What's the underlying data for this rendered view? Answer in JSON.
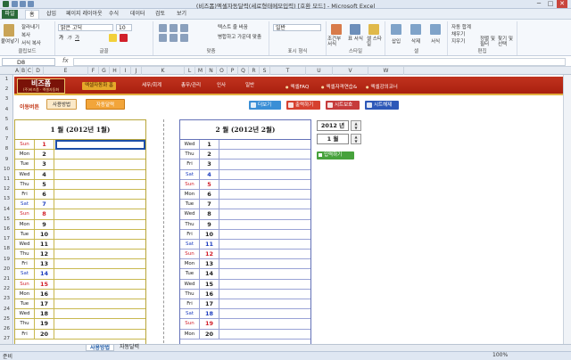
{
  "window": {
    "title": "(비즈폼)엑셀자동달력(세로형태메모입력) [호환 모드] - Microsoft Excel",
    "min": "─",
    "max": "□",
    "close": "✕"
  },
  "ribbon_tabs": [
    "파일",
    "홈",
    "삽입",
    "페이지 레이아웃",
    "수식",
    "데이터",
    "검토",
    "보기"
  ],
  "ribbon": {
    "clipboard": {
      "paste": "붙여넣기",
      "cut": "잘라내기",
      "copy": "복사",
      "format_painter": "서식 복사",
      "label": "클립보드"
    },
    "font": {
      "name": "맑은 고딕",
      "size": "10",
      "label": "글꼴"
    },
    "alignment": {
      "wrap": "텍스트 줄 바꿈",
      "merge": "병합하고 가운데 맞춤",
      "label": "맞춤"
    },
    "number": {
      "format": "일반",
      "label": "표시 형식"
    },
    "styles": {
      "conditional": "조건부 서식",
      "table": "표 서식",
      "cell": "셀 스타일",
      "label": "스타일"
    },
    "cells": {
      "insert": "삽입",
      "delete": "삭제",
      "format": "서식",
      "label": "셀"
    },
    "editing": {
      "autosum": "자동 합계",
      "fill": "채우기",
      "clear": "지우기",
      "sort": "정렬 및 필터",
      "find": "찾기 및 선택",
      "label": "편집"
    }
  },
  "formula_bar": {
    "name_box": "D8",
    "fx": "fx",
    "value": ""
  },
  "columns": [
    "A",
    "B",
    "C",
    "D",
    "E",
    "F",
    "G",
    "H",
    "I",
    "J",
    "K",
    "L",
    "M",
    "N",
    "O",
    "P",
    "Q",
    "R",
    "S",
    "T",
    "U",
    "V",
    "W"
  ],
  "rows": [
    "1",
    "2",
    "3",
    "4",
    "5",
    "6",
    "7",
    "8",
    "9",
    "10",
    "11",
    "12",
    "13",
    "14",
    "15",
    "16",
    "17",
    "18",
    "19",
    "20",
    "21",
    "22",
    "23",
    "24",
    "25",
    "26",
    "27"
  ],
  "banner": {
    "logo": "비즈폼",
    "logo_sub": "(주)비즈폼 · 엑셀자동화",
    "home": "엑셀자동화 홈",
    "nav": [
      "세무/회계",
      "총무/관리",
      "인사",
      "일반"
    ],
    "links": [
      "엑셀FAQ",
      "엑셀자격연습&",
      "엑셀강의코너"
    ]
  },
  "toolbar": {
    "label": "이동버튼",
    "usage": "사용방법",
    "auto": "자동달력",
    "more": "더보기",
    "print": "출력하기",
    "protect": "시트보호",
    "unprotect": "시트해제"
  },
  "calendar1": {
    "title": "1 월 (2012년 1월)",
    "days": [
      {
        "dow": "Sun",
        "d": "1",
        "t": "sun"
      },
      {
        "dow": "Mon",
        "d": "2",
        "t": ""
      },
      {
        "dow": "Tue",
        "d": "3",
        "t": ""
      },
      {
        "dow": "Wed",
        "d": "4",
        "t": ""
      },
      {
        "dow": "Thu",
        "d": "5",
        "t": ""
      },
      {
        "dow": "Fri",
        "d": "6",
        "t": ""
      },
      {
        "dow": "Sat",
        "d": "7",
        "t": "sat"
      },
      {
        "dow": "Sun",
        "d": "8",
        "t": "sun"
      },
      {
        "dow": "Mon",
        "d": "9",
        "t": ""
      },
      {
        "dow": "Tue",
        "d": "10",
        "t": ""
      },
      {
        "dow": "Wed",
        "d": "11",
        "t": ""
      },
      {
        "dow": "Thu",
        "d": "12",
        "t": ""
      },
      {
        "dow": "Fri",
        "d": "13",
        "t": ""
      },
      {
        "dow": "Sat",
        "d": "14",
        "t": "sat"
      },
      {
        "dow": "Sun",
        "d": "15",
        "t": "sun"
      },
      {
        "dow": "Mon",
        "d": "16",
        "t": ""
      },
      {
        "dow": "Tue",
        "d": "17",
        "t": ""
      },
      {
        "dow": "Wed",
        "d": "18",
        "t": ""
      },
      {
        "dow": "Thu",
        "d": "19",
        "t": ""
      },
      {
        "dow": "Fri",
        "d": "20",
        "t": ""
      }
    ]
  },
  "calendar2": {
    "title": "2 월 (2012년 2월)",
    "days": [
      {
        "dow": "Wed",
        "d": "1",
        "t": ""
      },
      {
        "dow": "Thu",
        "d": "2",
        "t": ""
      },
      {
        "dow": "Fri",
        "d": "3",
        "t": ""
      },
      {
        "dow": "Sat",
        "d": "4",
        "t": "sat"
      },
      {
        "dow": "Sun",
        "d": "5",
        "t": "sun"
      },
      {
        "dow": "Mon",
        "d": "6",
        "t": ""
      },
      {
        "dow": "Tue",
        "d": "7",
        "t": ""
      },
      {
        "dow": "Wed",
        "d": "8",
        "t": ""
      },
      {
        "dow": "Thu",
        "d": "9",
        "t": ""
      },
      {
        "dow": "Fri",
        "d": "10",
        "t": ""
      },
      {
        "dow": "Sat",
        "d": "11",
        "t": "sat"
      },
      {
        "dow": "Sun",
        "d": "12",
        "t": "sun"
      },
      {
        "dow": "Mon",
        "d": "13",
        "t": ""
      },
      {
        "dow": "Tue",
        "d": "14",
        "t": ""
      },
      {
        "dow": "Wed",
        "d": "15",
        "t": ""
      },
      {
        "dow": "Thu",
        "d": "16",
        "t": ""
      },
      {
        "dow": "Fri",
        "d": "17",
        "t": ""
      },
      {
        "dow": "Sat",
        "d": "18",
        "t": "sat"
      },
      {
        "dow": "Sun",
        "d": "19",
        "t": "sun"
      },
      {
        "dow": "Mon",
        "d": "20",
        "t": ""
      }
    ]
  },
  "year_spinner": {
    "value": "2012 년"
  },
  "month_spinner": {
    "value": "1 월"
  },
  "input_button": "입력하기",
  "sheet_tabs": [
    "사용방법",
    "자동달력"
  ],
  "status": {
    "ready": "준비",
    "zoom": "100%"
  }
}
